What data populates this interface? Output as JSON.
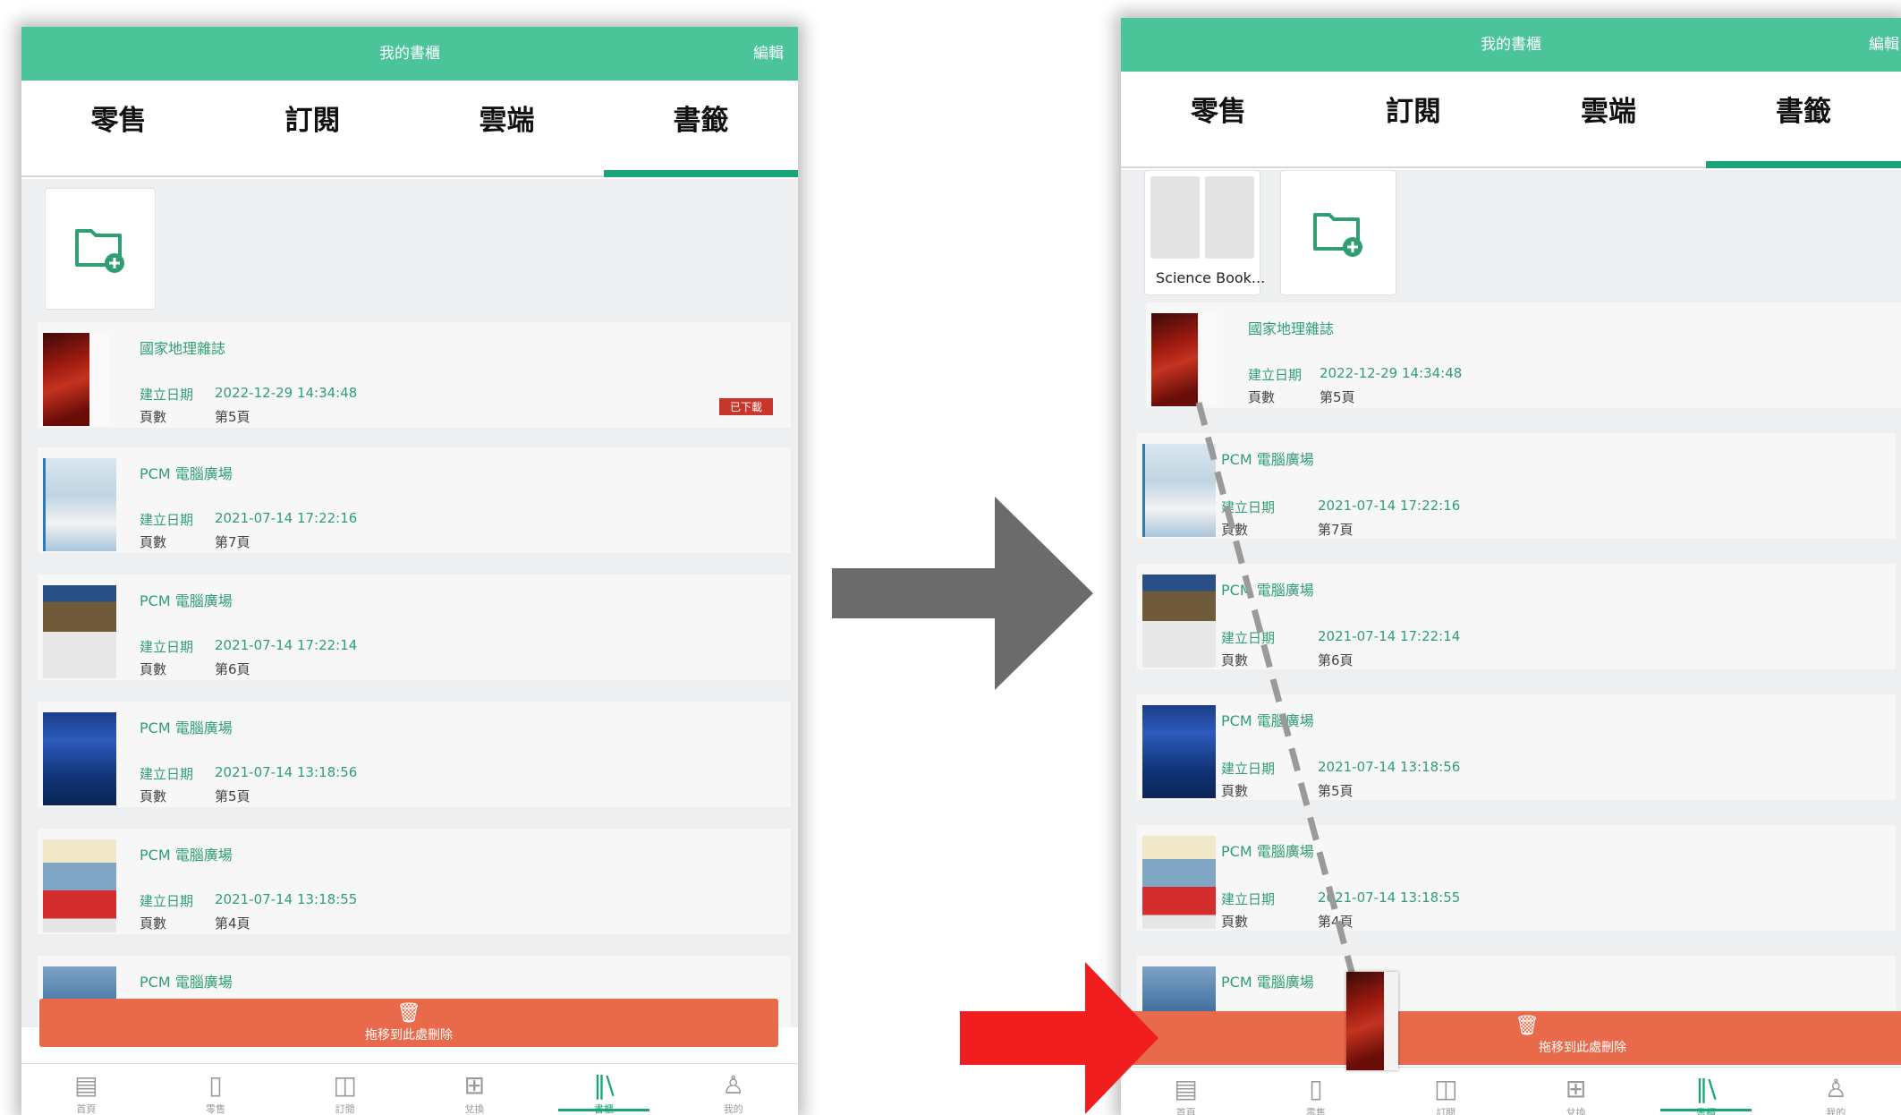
{
  "app": {
    "title": "我的書櫃",
    "edit_label": "編輯",
    "tabs": [
      "零售",
      "訂閱",
      "雲端",
      "書籤"
    ],
    "active_tab": "書籤",
    "accent_color": "#4cc49a",
    "delete_color": "#e96a4a"
  },
  "folder": {
    "name": "Science Book..."
  },
  "labels": {
    "created": "建立日期",
    "pages": "頁數",
    "downloaded_badge": "已下載",
    "delete_zone": "拖移到此處刪除"
  },
  "bookmarks": [
    {
      "title": "國家地理雜誌",
      "created": "2022-12-29 14:34:48",
      "page": "第5頁",
      "downloaded": true
    },
    {
      "title": "PCM 電腦廣場",
      "created": "2021-07-14 17:22:16",
      "page": "第7頁"
    },
    {
      "title": "PCM 電腦廣場",
      "created": "2021-07-14 17:22:14",
      "page": "第6頁"
    },
    {
      "title": "PCM 電腦廣場",
      "created": "2021-07-14 13:18:56",
      "page": "第5頁"
    },
    {
      "title": "PCM 電腦廣場",
      "created": "2021-07-14 13:18:55",
      "page": "第4頁"
    },
    {
      "title": "PCM 電腦廣場"
    }
  ],
  "bottom_nav": [
    {
      "label": "首頁",
      "icon": "home-icon"
    },
    {
      "label": "零售",
      "icon": "book-icon"
    },
    {
      "label": "訂閱",
      "icon": "subscription-icon"
    },
    {
      "label": "兌換",
      "icon": "gift-icon"
    },
    {
      "label": "書櫃",
      "icon": "bookshelf-icon",
      "active": true
    },
    {
      "label": "我的",
      "icon": "user-icon"
    }
  ]
}
